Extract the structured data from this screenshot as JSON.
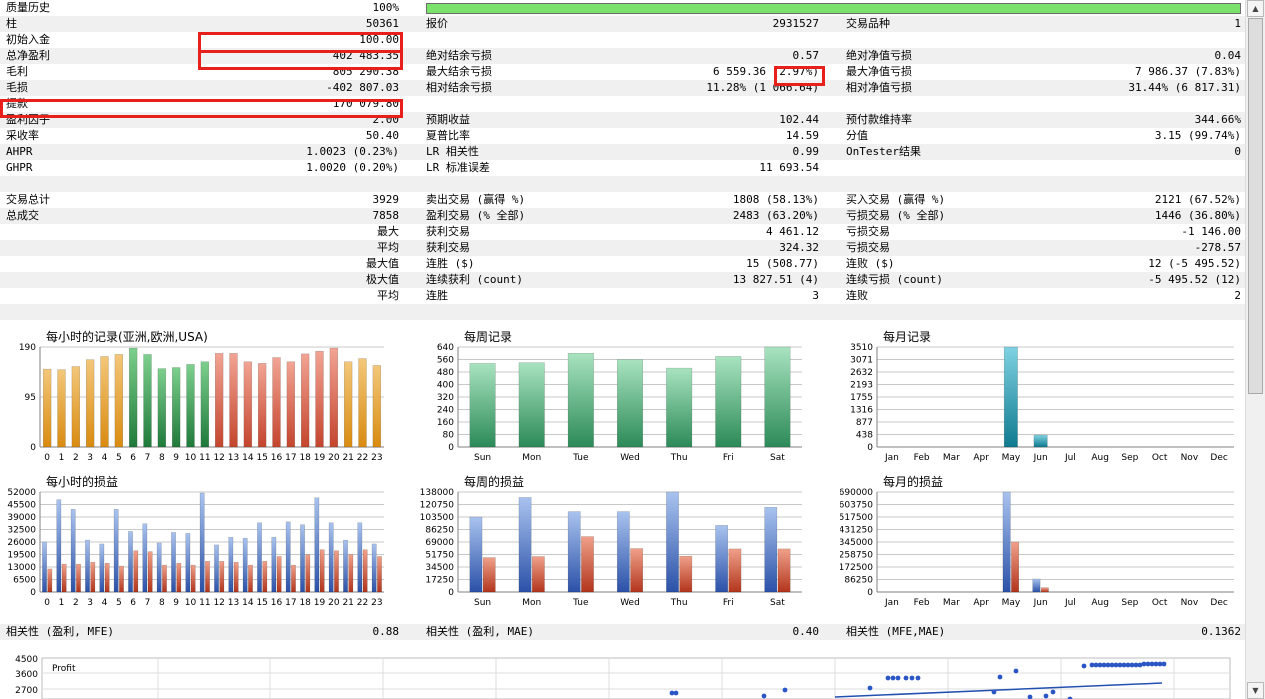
{
  "colors": {
    "quality_bar": "#7be36b",
    "highlight": "#e8201c",
    "row_gray": "#f0f0f0"
  },
  "rows": [
    {
      "top": 5,
      "gray": false,
      "bar": true,
      "cells": [
        "质量历史",
        "100%"
      ]
    },
    {
      "top": 21,
      "gray": true,
      "cells": [
        "柱",
        "50361",
        "报价",
        "2931527",
        "交易品种",
        "1"
      ]
    },
    {
      "top": 37,
      "gray": false,
      "cells": [
        "初始入金",
        "100.00",
        "",
        "",
        "",
        ""
      ]
    },
    {
      "top": 53,
      "gray": true,
      "cells": [
        "总净盈利",
        "402 483.35",
        "绝对结余亏损",
        "0.57",
        "绝对净值亏损",
        "0.04"
      ]
    },
    {
      "top": 69,
      "gray": false,
      "cells": [
        "毛利",
        "805 290.38",
        "最大结余亏损",
        "6 559.36 (2.97%)",
        "最大净值亏损",
        "7 986.37 (7.83%)"
      ]
    },
    {
      "top": 85,
      "gray": true,
      "cells": [
        "毛损",
        "-402 807.03",
        "相对结余亏损",
        "11.28% (1 066.64)",
        "相对净值亏损",
        "31.44% (6 817.31)"
      ]
    },
    {
      "top": 101,
      "gray": false,
      "cells": [
        "提款",
        "170 079.80",
        "",
        "",
        "",
        ""
      ]
    },
    {
      "top": 117,
      "gray": true,
      "cells": [
        "盈利因子",
        "2.00",
        "预期收益",
        "102.44",
        "预付款维持率",
        "344.66%"
      ]
    },
    {
      "top": 133,
      "gray": false,
      "cells": [
        "采收率",
        "50.40",
        "夏普比率",
        "14.59",
        "分值",
        "3.15 (99.74%)"
      ]
    },
    {
      "top": 149,
      "gray": true,
      "cells": [
        "AHPR",
        "1.0023 (0.23%)",
        "LR 相关性",
        "0.99",
        "OnTester结果",
        "0"
      ]
    },
    {
      "top": 165,
      "gray": false,
      "cells": [
        "GHPR",
        "1.0020 (0.20%)",
        "LR 标准误差",
        "11 693.54",
        "",
        ""
      ]
    },
    {
      "top": 181,
      "gray": true,
      "cells": [
        "",
        "",
        "",
        "",
        "",
        ""
      ]
    },
    {
      "top": 197,
      "gray": false,
      "cells": [
        "交易总计",
        "3929",
        "卖出交易 (赢得 %)",
        "1808 (58.13%)",
        "买入交易 (赢得 %)",
        "2121 (67.52%)"
      ]
    },
    {
      "top": 213,
      "gray": true,
      "cells": [
        "总成交",
        "7858",
        "盈利交易 (% 全部)",
        "2483 (63.20%)",
        "亏损交易 (% 全部)",
        "1446 (36.80%)"
      ]
    },
    {
      "top": 229,
      "gray": false,
      "cells": [
        "",
        "最大",
        "获利交易",
        "4 461.12",
        "亏损交易",
        "-1 146.00"
      ]
    },
    {
      "top": 245,
      "gray": true,
      "cells": [
        "",
        "平均",
        "获利交易",
        "324.32",
        "亏损交易",
        "-278.57"
      ]
    },
    {
      "top": 261,
      "gray": false,
      "cells": [
        "",
        "最大值",
        "连胜 ($)",
        "15 (508.77)",
        "连败 ($)",
        "12 (-5 495.52)"
      ]
    },
    {
      "top": 277,
      "gray": true,
      "cells": [
        "",
        "极大值",
        "连续获利 (count)",
        "13 827.51 (4)",
        "连续亏损 (count)",
        "-5 495.52 (12)"
      ]
    },
    {
      "top": 293,
      "gray": false,
      "cells": [
        "",
        "平均",
        "连胜",
        "3",
        "连败",
        "2"
      ]
    },
    {
      "top": 309,
      "gray": true,
      "cells": [
        "",
        "",
        "",
        "",
        "",
        ""
      ]
    },
    {
      "top": 629,
      "gray": true,
      "cells": [
        "相关性 (盈利, MFE)",
        "0.88",
        "相关性 (盈利, MAE)",
        "0.40",
        "相关性 (MFE,MAE)",
        "0.1362"
      ]
    }
  ],
  "chart_data": [
    {
      "id": "hourly_trades",
      "type": "bar",
      "title": "每小时的记录(亚洲,欧洲,USA)",
      "categories": [
        "0",
        "1",
        "2",
        "3",
        "4",
        "5",
        "6",
        "7",
        "8",
        "9",
        "10",
        "11",
        "12",
        "13",
        "14",
        "15",
        "16",
        "17",
        "18",
        "19",
        "20",
        "21",
        "22",
        "23"
      ],
      "ylim": [
        0,
        190
      ],
      "yticks": [
        "190",
        "95",
        "0"
      ],
      "series": [
        {
          "values": [
            148,
            147,
            153,
            166,
            172,
            176,
            188,
            176,
            149,
            151,
            157,
            162,
            178,
            178,
            162,
            159,
            170,
            162,
            177,
            182,
            188,
            162,
            168,
            155
          ],
          "colors": [
            "o",
            "o",
            "o",
            "o",
            "o",
            "o",
            "g",
            "g",
            "g",
            "g",
            "g",
            "g",
            "r",
            "r",
            "r",
            "r",
            "r",
            "r",
            "r",
            "r",
            "r",
            "o",
            "o",
            "o"
          ]
        }
      ]
    },
    {
      "id": "weekly_trades",
      "type": "bar",
      "title": "每周记录",
      "categories": [
        "Sun",
        "Mon",
        "Tue",
        "Wed",
        "Thu",
        "Fri",
        "Sat"
      ],
      "ylim": [
        0,
        640
      ],
      "yticks": [
        "640",
        "560",
        "480",
        "400",
        "320",
        "240",
        "160",
        "80",
        "0"
      ],
      "series": [
        {
          "values": [
            535,
            540,
            600,
            560,
            505,
            580,
            640
          ]
        }
      ]
    },
    {
      "id": "monthly_trades",
      "type": "bar",
      "title": "每月记录",
      "categories": [
        "Jan",
        "Feb",
        "Mar",
        "Apr",
        "May",
        "Jun",
        "Jul",
        "Aug",
        "Sep",
        "Oct",
        "Nov",
        "Dec"
      ],
      "ylim": [
        0,
        3510
      ],
      "yticks": [
        "3510",
        "3071",
        "2632",
        "2193",
        "1755",
        "1316",
        "877",
        "438",
        "0"
      ],
      "series": [
        {
          "values": [
            0,
            0,
            0,
            0,
            3510,
            419,
            0,
            0,
            0,
            0,
            0,
            0
          ]
        }
      ]
    },
    {
      "id": "hourly_pnl",
      "type": "bar",
      "title": "每小时的损益",
      "categories": [
        "0",
        "1",
        "2",
        "3",
        "4",
        "5",
        "6",
        "7",
        "8",
        "9",
        "10",
        "11",
        "12",
        "13",
        "14",
        "15",
        "16",
        "17",
        "18",
        "19",
        "20",
        "21",
        "22",
        "23"
      ],
      "ylim": [
        0,
        52000
      ],
      "yticks": [
        "52000",
        "45500",
        "39000",
        "32500",
        "26000",
        "19500",
        "13000",
        "6500",
        "0"
      ],
      "series": [
        {
          "name": "profit",
          "values": [
            26000,
            48000,
            43000,
            27000,
            25000,
            43000,
            31500,
            35500,
            25500,
            31000,
            30500,
            51500,
            24500,
            28500,
            28000,
            36000,
            28500,
            36500,
            35000,
            49000,
            36000,
            27000,
            36000,
            25000
          ]
        },
        {
          "name": "loss",
          "values": [
            12000,
            14500,
            14500,
            15500,
            15000,
            13500,
            21500,
            21000,
            14000,
            15000,
            14000,
            16000,
            16000,
            15500,
            14000,
            16000,
            18500,
            14000,
            19500,
            22000,
            21500,
            19500,
            22000,
            18500
          ]
        }
      ]
    },
    {
      "id": "weekly_pnl",
      "type": "bar",
      "title": "每周的损益",
      "categories": [
        "Sun",
        "Mon",
        "Tue",
        "Wed",
        "Thu",
        "Fri",
        "Sat"
      ],
      "ylim": [
        0,
        138000
      ],
      "yticks": [
        "138000",
        "120750",
        "103500",
        "86250",
        "69000",
        "51750",
        "34500",
        "17250",
        "0"
      ],
      "series": [
        {
          "name": "profit",
          "values": [
            103500,
            130500,
            111000,
            111000,
            138000,
            92000,
            117000
          ]
        },
        {
          "name": "loss",
          "values": [
            47500,
            49000,
            76500,
            60000,
            49500,
            59500,
            59500
          ]
        }
      ]
    },
    {
      "id": "monthly_pnl",
      "type": "bar",
      "title": "每月的损益",
      "categories": [
        "Jan",
        "Feb",
        "Mar",
        "Apr",
        "May",
        "Jun",
        "Jul",
        "Aug",
        "Sep",
        "Oct",
        "Nov",
        "Dec"
      ],
      "ylim": [
        0,
        690000
      ],
      "yticks": [
        "690000",
        "603750",
        "517500",
        "431250",
        "345000",
        "258750",
        "172500",
        "86250",
        "0"
      ],
      "series": [
        {
          "name": "profit",
          "values": [
            0,
            0,
            0,
            0,
            690000,
            90000,
            0,
            0,
            0,
            0,
            0,
            0
          ]
        },
        {
          "name": "loss",
          "values": [
            0,
            0,
            0,
            0,
            345000,
            30000,
            0,
            0,
            0,
            0,
            0,
            0
          ]
        }
      ]
    },
    {
      "id": "scatter_profit",
      "type": "scatter",
      "title": "",
      "ylabel": "Profit",
      "yticks": [
        "4500",
        "3600",
        "2700"
      ]
    }
  ]
}
